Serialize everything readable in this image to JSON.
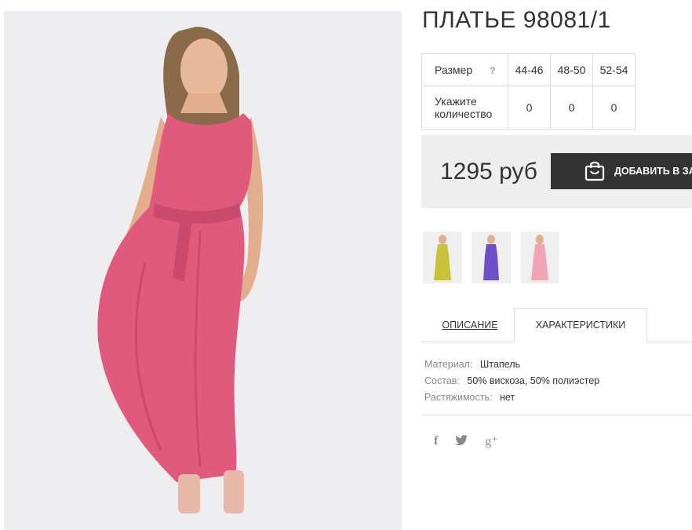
{
  "product": {
    "title": "ПЛАТЬЕ 98081/1",
    "photo_alt": "pink-dress-photo"
  },
  "size_table": {
    "size_label": "Размер",
    "help_icon": "?",
    "sizes": [
      "44-46",
      "48-50",
      "52-54"
    ],
    "qty_label_line1": "Укажите",
    "qty_label_line2": "количество",
    "quantities": [
      "0",
      "0",
      "0"
    ]
  },
  "purchase": {
    "price": "1295 руб",
    "add_to_cart_label": "ДОБАВИТЬ В ЗАКАЗ",
    "bag_icon": "shopping-bag-icon"
  },
  "thumbnails": [
    {
      "name": "thumb-yellow",
      "color": "#c7c23a"
    },
    {
      "name": "thumb-purple",
      "color": "#6d4fc8"
    },
    {
      "name": "thumb-pink",
      "color": "#f0a6b6"
    }
  ],
  "tabs": {
    "description": "ОПИСАНИЕ",
    "characteristics": "ХАРАКТЕРИСТИКИ"
  },
  "characteristics": [
    {
      "key": "Материал:",
      "value": "Штапель"
    },
    {
      "key": "Состав:",
      "value": "50% вискоза, 50% полиэстер"
    },
    {
      "key": "Растяжимость:",
      "value": "нет"
    }
  ],
  "social": {
    "facebook": "f",
    "twitter": "🐦",
    "googleplus": "g⁺"
  },
  "colors": {
    "dress": "#e05a7e",
    "button_bg": "#333333",
    "band_bg": "#eeeeee"
  }
}
